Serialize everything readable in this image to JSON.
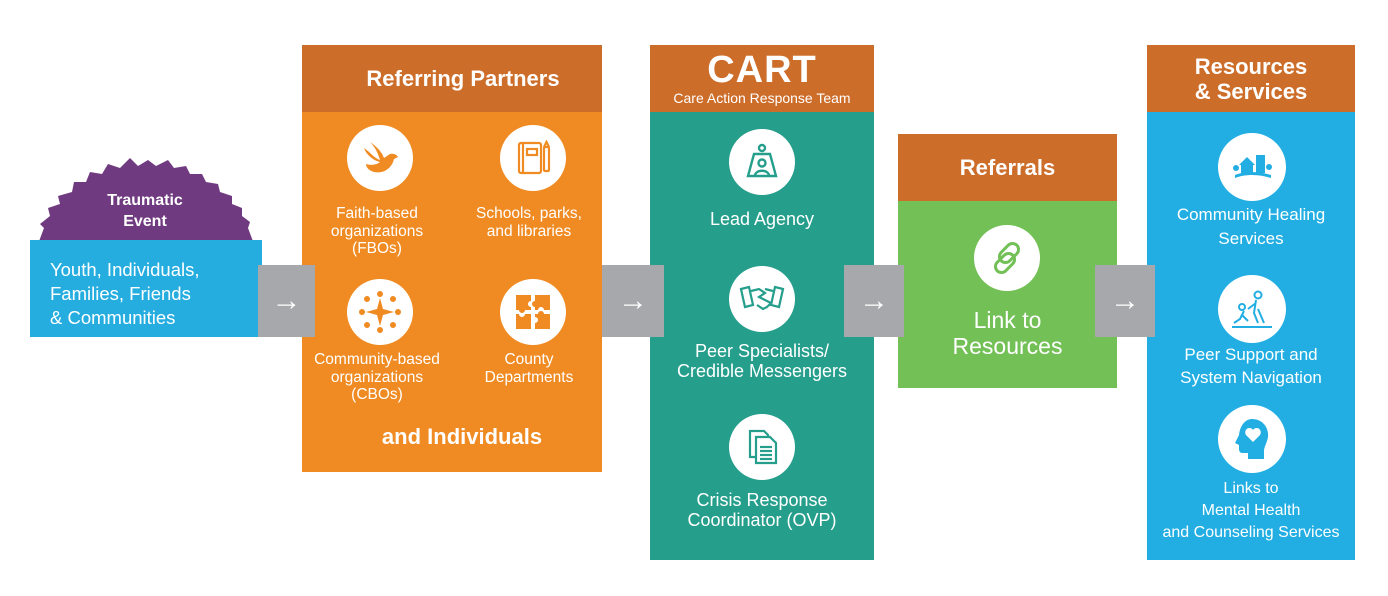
{
  "colors": {
    "header": "#cd6d2a",
    "entry_blue": "#25ade0",
    "burst_purple": "#703a80",
    "partners_orange": "#ef8b22",
    "cart_teal": "#259e8c",
    "referrals_green": "#73c057",
    "resources_blue": "#22aee2",
    "arrow_gray": "#a7a8ab"
  },
  "entry": {
    "burst_label": "Traumatic Event",
    "burst_line1": "Traumatic",
    "burst_line2": "Event",
    "line1": "Youth, Individuals,",
    "line2": "Families, Friends",
    "line3": "& Communities"
  },
  "arrow_glyph": "→",
  "partners": {
    "title": "Referring Partners",
    "footer": "and Individuals",
    "items": [
      {
        "icon": "dove-icon",
        "lines": [
          "Faith-based",
          "organizations",
          "(FBOs)"
        ]
      },
      {
        "icon": "notebook-pencil-icon",
        "lines": [
          "Schools, parks,",
          "and libraries"
        ]
      },
      {
        "icon": "community-circle-icon",
        "lines": [
          "Community-based",
          "organizations",
          "(CBOs)"
        ]
      },
      {
        "icon": "puzzle-icon",
        "lines": [
          "County",
          "Departments"
        ]
      }
    ]
  },
  "cart": {
    "title": "CART",
    "subtitle": "Care Action Response Team",
    "items": [
      {
        "icon": "lead-agency-icon",
        "lines": [
          "Lead Agency"
        ]
      },
      {
        "icon": "handshake-icon",
        "lines": [
          "Peer Specialists/",
          "Credible Messengers"
        ]
      },
      {
        "icon": "documents-icon",
        "lines": [
          "Crisis Response",
          "Coordinator (OVP)"
        ]
      }
    ]
  },
  "referrals": {
    "title": "Referrals",
    "icon": "link-icon",
    "lines": [
      "Link to",
      "Resources"
    ]
  },
  "resources": {
    "title_line1": "Resources",
    "title_line2": "& Services",
    "items": [
      {
        "icon": "community-town-icon",
        "lines": [
          "Community Healing",
          "Services"
        ]
      },
      {
        "icon": "helping-hand-icon",
        "lines": [
          "Peer Support and",
          "System Navigation"
        ]
      },
      {
        "icon": "head-heart-icon",
        "lines": [
          "Links to",
          "Mental Health",
          "and Counseling Services"
        ]
      }
    ]
  }
}
